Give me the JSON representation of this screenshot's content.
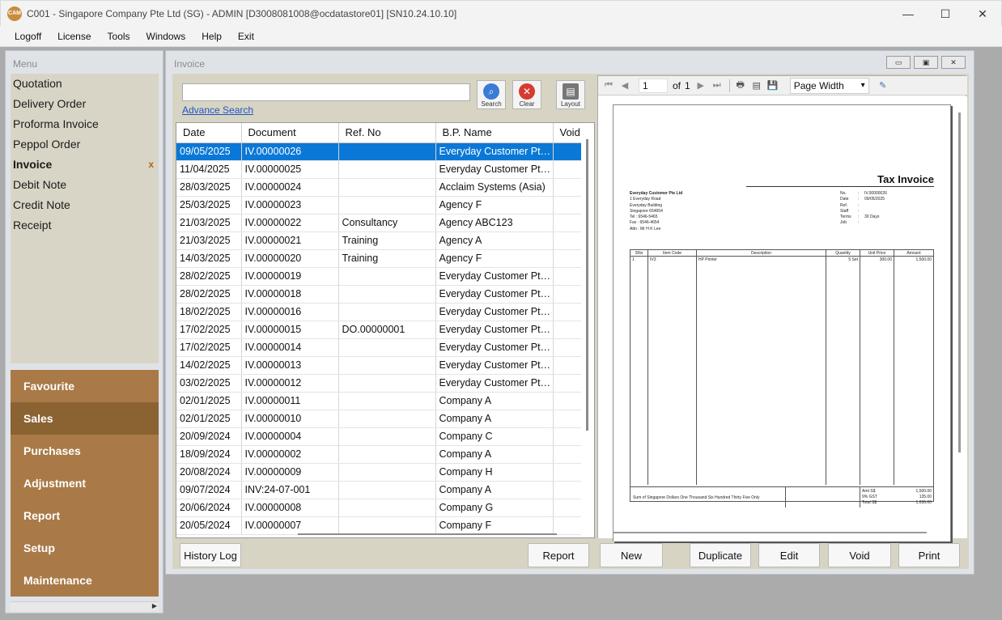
{
  "window": {
    "app_icon": "CAM",
    "title": "C001 - Singapore Company Pte Ltd (SG) - ADMIN [D3008081008@ocdatastore01] [SN10.24.10.10]",
    "minimize_icon": "—",
    "maximize_icon": "☐",
    "close_icon": "✕"
  },
  "menubar": [
    "Logoff",
    "License",
    "Tools",
    "Windows",
    "Help",
    "Exit"
  ],
  "sidebar": {
    "header": "Menu",
    "items": [
      {
        "label": "Quotation"
      },
      {
        "label": "Delivery Order"
      },
      {
        "label": "Proforma Invoice"
      },
      {
        "label": "Peppol Order"
      },
      {
        "label": "Invoice",
        "active": true
      },
      {
        "label": "Debit Note"
      },
      {
        "label": "Credit Note"
      },
      {
        "label": "Receipt"
      }
    ],
    "active_close": "x",
    "modules": [
      {
        "label": "Favourite"
      },
      {
        "label": "Sales",
        "active": true
      },
      {
        "label": "Purchases"
      },
      {
        "label": "Adjustment"
      },
      {
        "label": "Report"
      },
      {
        "label": "Setup"
      },
      {
        "label": "Maintenance"
      }
    ]
  },
  "invoice_window": {
    "title": "Invoice",
    "search": {
      "value": "",
      "placeholder": ""
    },
    "advance_search": "Advance Search",
    "search_btn": "Search",
    "clear_btn": "Clear",
    "layout_btn": "Layout",
    "columns": [
      "Date",
      "Document",
      "Ref. No",
      "B.P. Name",
      "Void"
    ],
    "rows": [
      [
        "09/05/2025",
        "IV.00000026",
        "",
        "Everyday Customer Pte Ltd",
        ""
      ],
      [
        "11/04/2025",
        "IV.00000025",
        "",
        "Everyday Customer Pte Ltd",
        ""
      ],
      [
        "28/03/2025",
        "IV.00000024",
        "",
        "Acclaim Systems (Asia)",
        ""
      ],
      [
        "25/03/2025",
        "IV.00000023",
        "",
        "Agency F",
        ""
      ],
      [
        "21/03/2025",
        "IV.00000022",
        "Consultancy",
        "Agency ABC123",
        ""
      ],
      [
        "21/03/2025",
        "IV.00000021",
        "Training",
        "Agency A",
        ""
      ],
      [
        "14/03/2025",
        "IV.00000020",
        "Training",
        "Agency F",
        ""
      ],
      [
        "28/02/2025",
        "IV.00000019",
        "",
        "Everyday Customer Pte Ltd",
        ""
      ],
      [
        "28/02/2025",
        "IV.00000018",
        "",
        "Everyday Customer Pte Ltd",
        ""
      ],
      [
        "18/02/2025",
        "IV.00000016",
        "",
        "Everyday Customer Pte Ltd",
        ""
      ],
      [
        "17/02/2025",
        "IV.00000015",
        "DO.00000001",
        "Everyday Customer Pte Ltd",
        ""
      ],
      [
        "17/02/2025",
        "IV.00000014",
        "",
        "Everyday Customer Pte Ltd",
        ""
      ],
      [
        "14/02/2025",
        "IV.00000013",
        "",
        "Everyday Customer Pte Ltd",
        ""
      ],
      [
        "03/02/2025",
        "IV.00000012",
        "",
        "Everyday Customer Pte Ltd",
        ""
      ],
      [
        "02/01/2025",
        "IV.00000011",
        "",
        "Company A",
        ""
      ],
      [
        "02/01/2025",
        "IV.00000010",
        "",
        "Company A",
        ""
      ],
      [
        "20/09/2024",
        "IV.00000004",
        "",
        "Company C",
        ""
      ],
      [
        "18/09/2024",
        "IV.00000002",
        "",
        "Company A",
        ""
      ],
      [
        "20/08/2024",
        "IV.00000009",
        "",
        "Company H",
        ""
      ],
      [
        "09/07/2024",
        "INV:24-07-001",
        "",
        "Company A",
        ""
      ],
      [
        "20/06/2024",
        "IV.00000008",
        "",
        "Company G",
        ""
      ],
      [
        "20/05/2024",
        "IV.00000007",
        "",
        "Company F",
        ""
      ]
    ],
    "selected_row": 0,
    "buttons": {
      "history_log": "History Log",
      "report": "Report",
      "new": "New",
      "duplicate": "Duplicate",
      "edit": "Edit",
      "void": "Void",
      "print": "Print"
    }
  },
  "viewer": {
    "page": "1",
    "of_label": "of",
    "total_pages": "1",
    "zoom": "Page Width",
    "first_icon": "⏮",
    "prev_icon": "◀",
    "next_icon": "▶",
    "last_icon": "⏭",
    "print_icon": "🖶",
    "layout_icon": "▤",
    "export_icon": "💾",
    "edit_icon": "✎"
  },
  "document": {
    "title": "Tax Invoice",
    "customer": {
      "name": "Everyday Customer Pte Ltd",
      "address1": "1 Everyday Road",
      "address2": "Everyday Building",
      "address3": "Singapore 654654",
      "tel": "Tel : 6546-5465",
      "fax": "Fax : 6546-4654",
      "attn": "Attn : Mr H K Lee"
    },
    "meta": [
      {
        "k": "No.",
        "v": "IV.00000026"
      },
      {
        "k": "Date",
        "v": "09/05/2025"
      },
      {
        "k": "Ref.",
        "v": ""
      },
      {
        "k": "Staff",
        "v": ""
      },
      {
        "k": "Terms",
        "v": "30 Days"
      },
      {
        "k": "Job",
        "v": ""
      }
    ],
    "line_headers": [
      "SNo",
      "Item Code",
      "Description",
      "Quantity",
      "Unit Price",
      "Amount"
    ],
    "line": {
      "sno": "1",
      "code": "IV3",
      "desc": "HP Printer",
      "qty": "5 Set",
      "price": "300.00",
      "amount": "1,500.00"
    },
    "amount_words": "Sum of Singapore Dollars One Thousand Six Hundred Thirty Five Only",
    "totals": [
      {
        "k": "Amt S$",
        "v": "1,500.00"
      },
      {
        "k": "9% GST",
        "v": "135.00"
      },
      {
        "k": "Total S$",
        "v": "1,635.00"
      }
    ]
  }
}
